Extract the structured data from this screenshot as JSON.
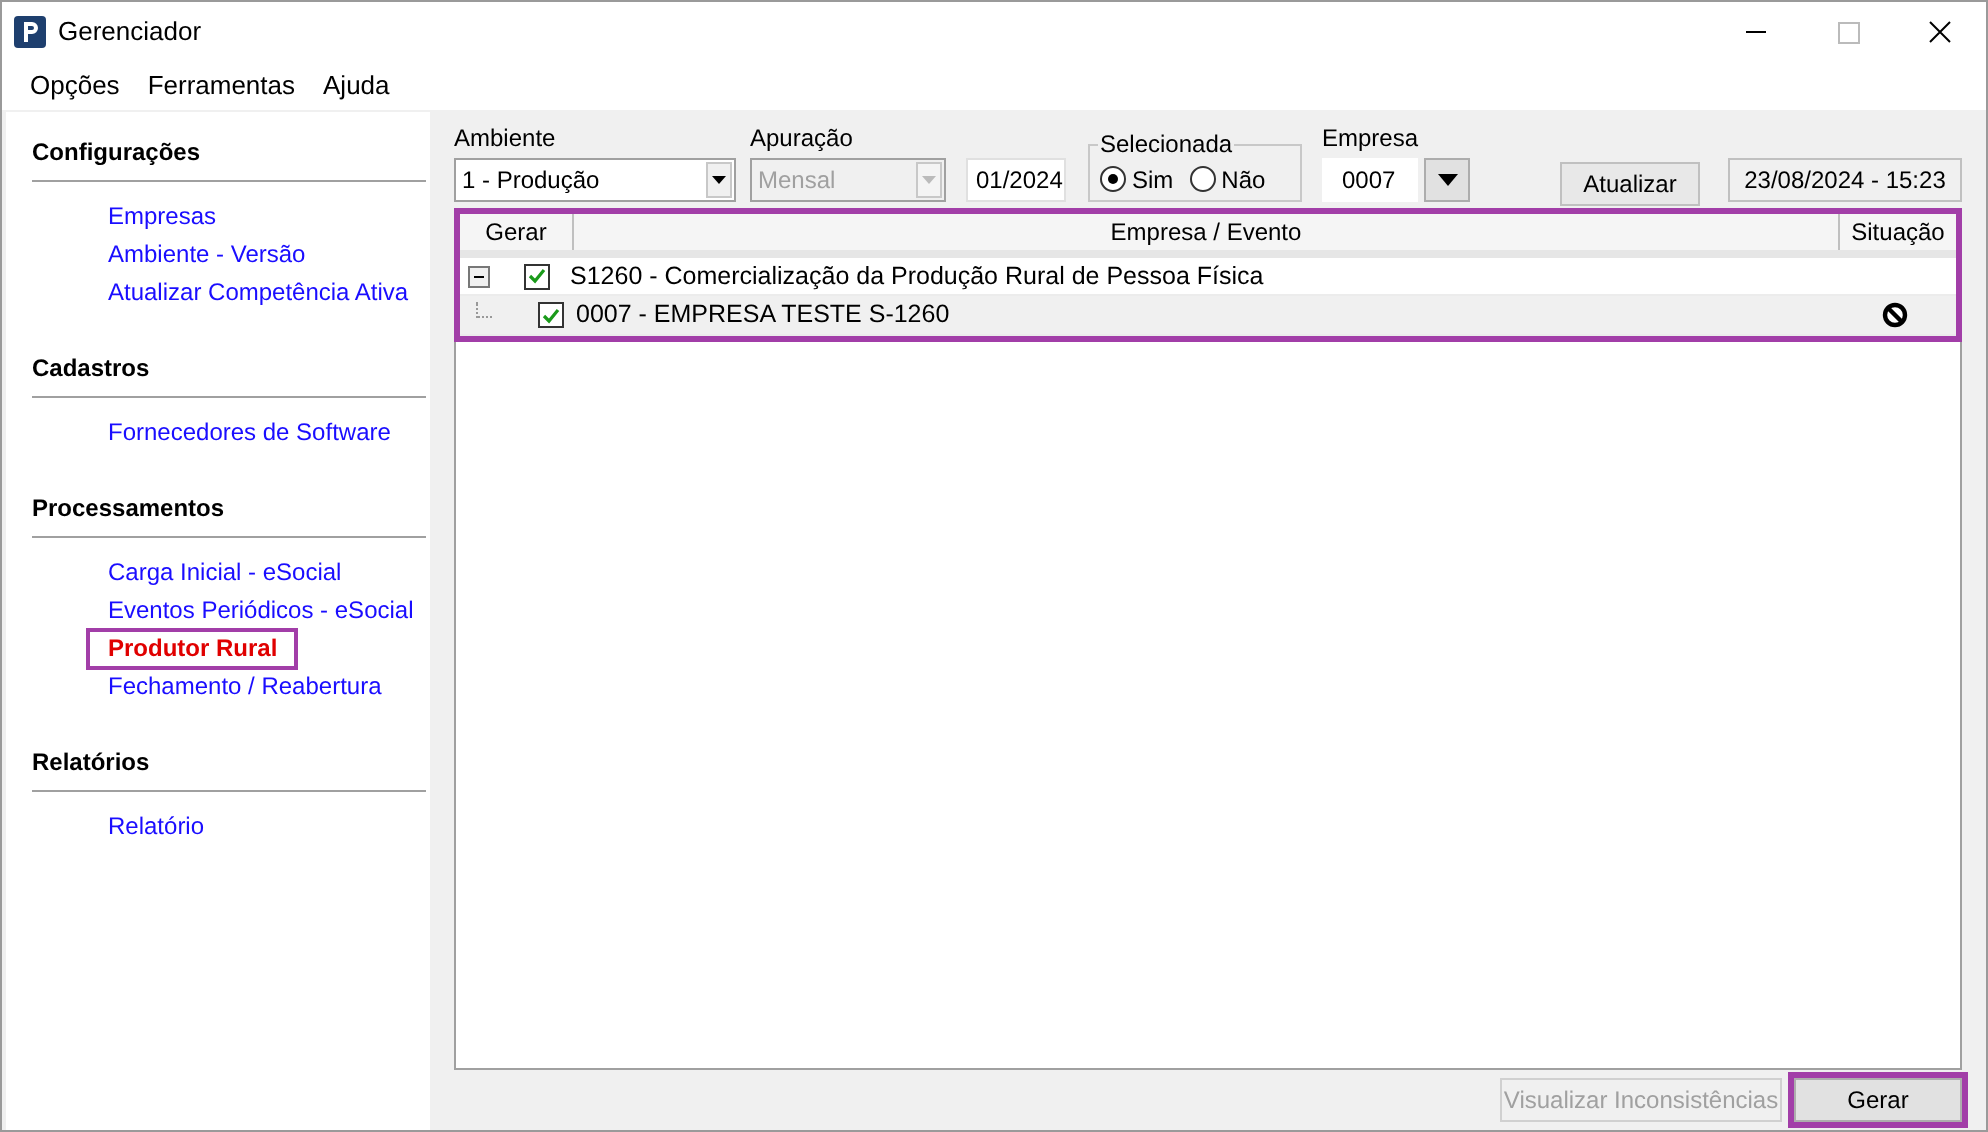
{
  "window": {
    "title": "Gerenciador"
  },
  "menu": [
    "Opções",
    "Ferramentas",
    "Ajuda"
  ],
  "sidebar": [
    {
      "title": "Configurações",
      "items": [
        {
          "label": "Empresas",
          "selected": false
        },
        {
          "label": "Ambiente - Versão",
          "selected": false
        },
        {
          "label": "Atualizar Competência Ativa",
          "selected": false
        }
      ]
    },
    {
      "title": "Cadastros",
      "items": [
        {
          "label": "Fornecedores de Software",
          "selected": false
        }
      ]
    },
    {
      "title": "Processamentos",
      "items": [
        {
          "label": "Carga Inicial - eSocial",
          "selected": false
        },
        {
          "label": "Eventos Periódicos - eSocial",
          "selected": false
        },
        {
          "label": "Produtor Rural",
          "selected": true
        },
        {
          "label": "Fechamento / Reabertura",
          "selected": false
        }
      ]
    },
    {
      "title": "Relatórios",
      "items": [
        {
          "label": "Relatório",
          "selected": false
        }
      ]
    }
  ],
  "filters": {
    "ambiente": {
      "label": "Ambiente",
      "value": "1 - Produção",
      "disabled": false
    },
    "apuracao": {
      "label": "Apuração",
      "value": "Mensal",
      "disabled": true
    },
    "periodo": "01/2024",
    "selecionada": {
      "label": "Selecionada",
      "options": [
        {
          "label": "Sim",
          "selected": true
        },
        {
          "label": "Não",
          "selected": false
        }
      ]
    },
    "empresa": {
      "label": "Empresa",
      "value": "0007"
    },
    "atualizar": "Atualizar",
    "timestamp": "23/08/2024 - 15:23"
  },
  "grid": {
    "highlighted": true,
    "columns": [
      "Gerar",
      "Empresa / Evento",
      "Situação"
    ],
    "rows": [
      {
        "text": "S1260 - Comercialização da Produção Rural de Pessoa Física",
        "checked": true,
        "expanded": true,
        "children": [
          {
            "text": "0007 - EMPRESA TESTE S-1260",
            "checked": true,
            "blocked": true
          }
        ]
      }
    ]
  },
  "buttons": [
    {
      "label": "Visualizar Inconsistências",
      "disabled": true,
      "highlighted": false
    },
    {
      "label": "Gerar",
      "disabled": false,
      "highlighted": true
    }
  ]
}
